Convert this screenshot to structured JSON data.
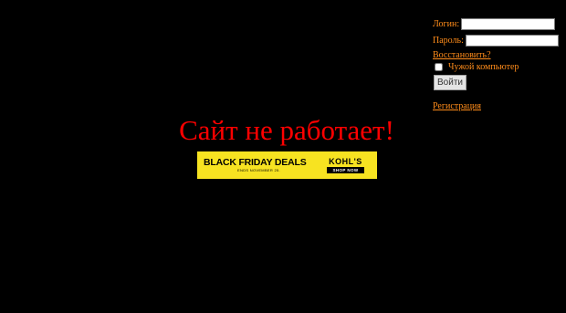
{
  "login_form": {
    "login_label": "Логин:",
    "login_value": "",
    "password_label": "Пароль:",
    "password_value": "",
    "recover_link": "Восстановить?",
    "foreign_computer_label": "Чужой компьютер",
    "foreign_computer_checked": false,
    "submit_label": "Войти",
    "register_link": "Регистрация"
  },
  "main": {
    "headline": "Сайт не работает!"
  },
  "ad": {
    "title": "BLACK FRIDAY DEALS",
    "subtitle": "ENDS NOVEMBER 25.",
    "brand": "KOHL'S",
    "cta": "SHOP NOW"
  },
  "colors": {
    "background": "#000000",
    "headline": "#ff0000",
    "panel_text": "#ff8c1a",
    "ad_background": "#f7e321"
  }
}
